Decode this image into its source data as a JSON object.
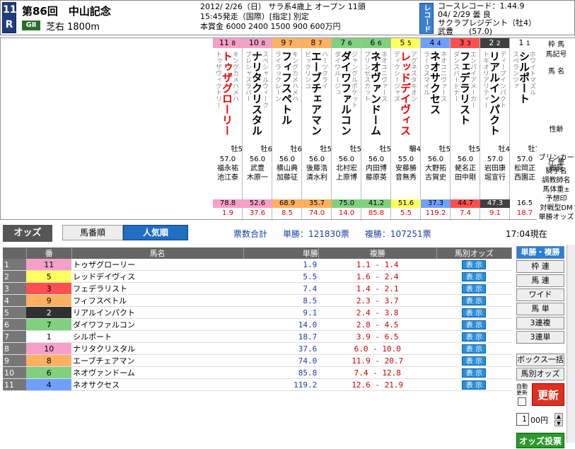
{
  "header": {
    "race_no_top": "11",
    "race_no_bottom": "R",
    "title": "第86回　中山記念",
    "grade": "GⅡ",
    "course": "芝右 1800m",
    "info_line1": "2012/ 2/26（日） サラ系4歳上 オープン 11頭",
    "info_line2": "15:45発走（国際）[指定] 別定",
    "info_line3": "本賞金 6000 2400 1500 900 600万円",
    "record_badge": "レコード",
    "record_line1": "コースレコード：1.44.9",
    "record_line2": "04/ 2/29 曇 良",
    "record_line3": "サクラプレジデント（牡4）",
    "record_line4": "武豊　　(57.0)"
  },
  "card": {
    "right_labels": [
      "枠 馬",
      "馬記号",
      "馬 名",
      "性齢",
      "ブリンカー",
      "脚質",
      "斤 量",
      "騎手名",
      "調教師名",
      "馬体重±",
      "予想印",
      "対戦型DM",
      "単勝オッズ"
    ],
    "horses": [
      {
        "frame": "8",
        "num": "11",
        "name": "トゥザグローリー",
        "sire": "キングカメハメハ",
        "dam": "トゥザヴィクトリー",
        "sex_age": "牡5",
        "weight": "57.0",
        "jockey": "福永祐",
        "trainer": "池江泰",
        "dm": "78.8",
        "odds": "1.9",
        "frame_color": "#f5a0c8"
      },
      {
        "frame": "8",
        "num": "10",
        "name": "ナリタクリスタル",
        "sire": "スペシャルウィーク",
        "dam": "ブレシャスラバー",
        "sex_age": "牡6",
        "weight": "56.0",
        "jockey": "武豊",
        "trainer": "木原一",
        "dm": "52.6",
        "odds": "37.6",
        "frame_color": "#f5a0c8"
      },
      {
        "frame": "7",
        "num": "9",
        "name": "フィフスペトル",
        "sire": "キングカメハメハ",
        "dam": "ライラックレーン",
        "sex_age": "牡6",
        "weight": "56.0",
        "jockey": "横山典",
        "trainer": "加藤征",
        "dm": "68.9",
        "odds": "8.5",
        "frame_color": "#ffb060"
      },
      {
        "frame": "7",
        "num": "8",
        "name": "エーブチェアマン",
        "sire": "ハーツクライ",
        "dam": "ビックリンコ",
        "sex_age": "牡5",
        "weight": "56.0",
        "jockey": "後藤浩",
        "trainer": "清水利",
        "dm": "35.7",
        "odds": "74.0",
        "frame_color": "#ffb060"
      },
      {
        "frame": "6",
        "num": "7",
        "name": "ダイワファルコン",
        "sire": "ジャングルポケット",
        "dam": "ダイワルージュ",
        "sex_age": "牡5",
        "weight": "56.0",
        "jockey": "北村宏",
        "trainer": "上原博",
        "dm": "75.0",
        "odds": "14.0",
        "frame_color": "#80d080"
      },
      {
        "frame": "6",
        "num": "6",
        "name": "ネオヴァンドーム",
        "sire": "ネオユニヴァース",
        "dam": "プリンセスカット",
        "sex_age": "牡5",
        "weight": "56.0",
        "jockey": "内田博",
        "trainer": "藤原英",
        "dm": "41.2",
        "odds": "85.8",
        "frame_color": "#80d080"
      },
      {
        "frame": "5",
        "num": "5",
        "name": "レッドデイヴィス",
        "sire": "アグネスタキオン",
        "dam": "ディクシージャズ",
        "sex_age": "騸4",
        "weight": "55.0",
        "jockey": "安藤勝",
        "trainer": "音無秀",
        "dm": "51.6",
        "odds": "5.5",
        "frame_color": "#ffff60"
      },
      {
        "frame": "4",
        "num": "4",
        "name": "ネオサクセス",
        "sire": "ネオユニヴァース",
        "dam": "ラークスマイル",
        "sex_age": "牡5",
        "weight": "56.0",
        "jockey": "大野拓",
        "trainer": "古賀史",
        "dm": "37.3",
        "odds": "119.2",
        "frame_color": "#6fa0ff"
      },
      {
        "frame": "3",
        "num": "3",
        "name": "フェデラリスト",
        "sire": "エンパイアメーカー",
        "dam": "ダンスパートナー",
        "sex_age": "牡5",
        "weight": "56.0",
        "jockey": "蛯名正",
        "trainer": "田中剛",
        "dm": "44.7",
        "odds": "7.4",
        "frame_color": "#ff5050"
      },
      {
        "frame": "2",
        "num": "2",
        "name": "リアルインパクト",
        "sire": "ディープインパクト",
        "dam": "トキオリアリティー",
        "sex_age": "牡4",
        "weight": "57.0",
        "jockey": "岩田康",
        "trainer": "堀宣行",
        "dm": "47.3",
        "odds": "9.1",
        "frame_color": "#404040"
      },
      {
        "frame": "1",
        "num": "1",
        "name": "シルポート",
        "sire": "ホワイトマズル",
        "dam": "スペランツァ",
        "sex_age": "牡7",
        "weight": "57.0",
        "jockey": "松岡正",
        "trainer": "西園正",
        "dm": "16.5",
        "odds": "18.7",
        "frame_color": "#ffffff"
      }
    ]
  },
  "odds": {
    "title": "オッズ",
    "tab_ban": "馬番順",
    "tab_nin": "人気順",
    "summary_total": "票数合計",
    "summary_win": "単勝：121830票",
    "summary_place": "複勝：107251票",
    "time": "17:04現在",
    "columns": [
      "番",
      "馬名",
      "単勝",
      "複勝",
      "馬別オッズ"
    ],
    "rows": [
      {
        "rank": "1",
        "num": "11",
        "color": "#f5a0c8",
        "name": "トゥザグローリー",
        "win": "1.9",
        "plc": "1.1 -   1.4",
        "btn": "表 示"
      },
      {
        "rank": "2",
        "num": "5",
        "color": "#ffff60",
        "name": "レッドデイヴィス",
        "win": "5.5",
        "plc": "1.6 -   2.4",
        "btn": "表 示"
      },
      {
        "rank": "3",
        "num": "3",
        "color": "#ff5050",
        "name": "フェデラリスト",
        "win": "7.4",
        "plc": "1.4 -   2.1",
        "btn": "表 示"
      },
      {
        "rank": "4",
        "num": "9",
        "color": "#ffb060",
        "name": "フィフスペトル",
        "win": "8.5",
        "plc": "2.3 -   3.7",
        "btn": "表 示"
      },
      {
        "rank": "5",
        "num": "2",
        "color": "#303030",
        "name": "リアルインパクト",
        "win": "9.1",
        "plc": "2.4 -   3.8",
        "btn": "表 示"
      },
      {
        "rank": "6",
        "num": "7",
        "color": "#80d080",
        "name": "ダイワファルコン",
        "win": "14.0",
        "plc": "2.8 -   4.5",
        "btn": "表 示"
      },
      {
        "rank": "7",
        "num": "1",
        "color": "#ffffff",
        "name": "シルポート",
        "win": "18.7",
        "plc": "3.9 -   6.5",
        "btn": "表 示"
      },
      {
        "rank": "8",
        "num": "10",
        "color": "#f5a0c8",
        "name": "ナリタクリスタル",
        "win": "37.6",
        "plc": "6.0 -   10.0",
        "btn": "表 示"
      },
      {
        "rank": "9",
        "num": "8",
        "color": "#ffb060",
        "name": "エーブチェアマン",
        "win": "74.0",
        "plc": "11.9 -   20.7",
        "btn": "表 示"
      },
      {
        "rank": "10",
        "num": "6",
        "color": "#80d080",
        "name": "ネオヴァンドーム",
        "win": "85.8",
        "plc": "7.4 -   12.8",
        "btn": "表 示"
      },
      {
        "rank": "11",
        "num": "4",
        "color": "#6fa0ff",
        "name": "ネオサクセス",
        "win": "119.2",
        "plc": "12.6 -   21.9",
        "btn": "表 示"
      }
    ]
  },
  "side": {
    "buttons": [
      "単勝・複勝",
      "枠 連",
      "馬 連",
      "ワイド",
      "馬 単",
      "3連複",
      "3連単"
    ],
    "box": "ボックス一括",
    "horse_odds": "馬別オッズ",
    "auto_label": "自動更新",
    "refresh": "更新",
    "amount_value": "1",
    "amount_unit": "00円",
    "vote": "オッズ投票"
  }
}
